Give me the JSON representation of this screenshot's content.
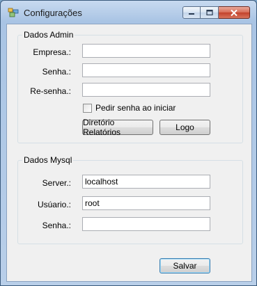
{
  "window": {
    "title": "Configurações"
  },
  "admin": {
    "group_label": "Dados Admin",
    "empresa_label": "Empresa.:",
    "empresa_value": "",
    "senha_label": "Senha.:",
    "senha_value": "",
    "resenha_label": "Re-senha.:",
    "resenha_value": "",
    "pedir_senha_label": "Pedir senha ao iniciar",
    "pedir_senha_checked": false,
    "diretorio_button": "Diretório Relatórios",
    "logo_button": "Logo"
  },
  "mysql": {
    "group_label": "Dados Mysql",
    "server_label": "Server.:",
    "server_value": "localhost",
    "usuario_label": "Usúario.:",
    "usuario_value": "root",
    "senha_label": "Senha.:",
    "senha_value": ""
  },
  "footer": {
    "save_button": "Salvar"
  }
}
